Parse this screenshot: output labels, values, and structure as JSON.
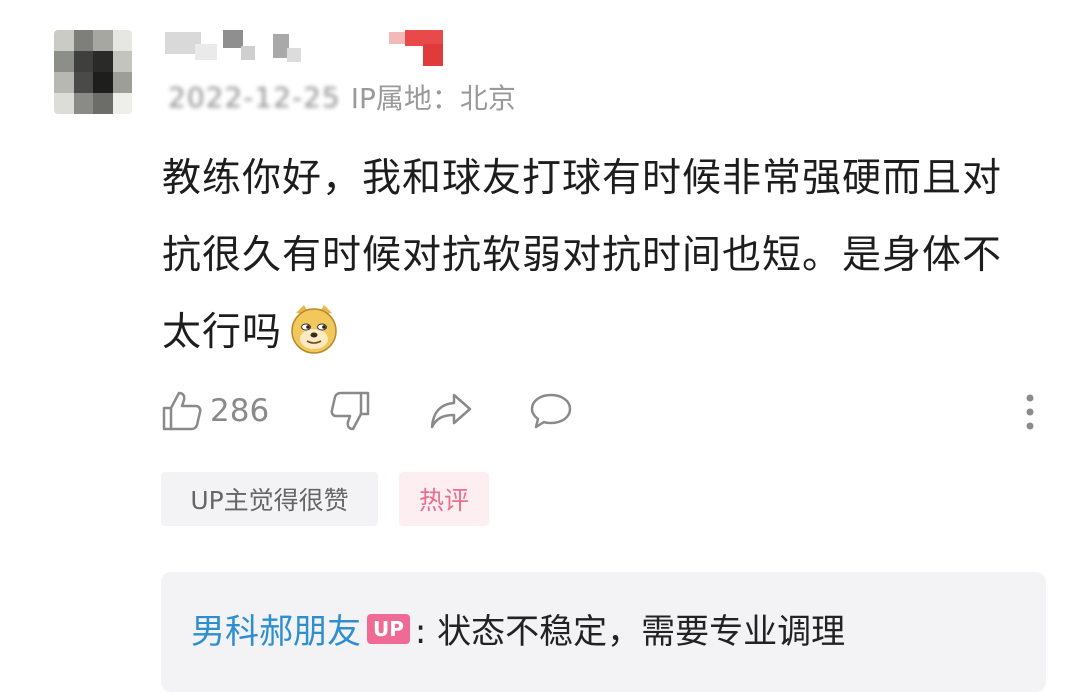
{
  "comment": {
    "meta": {
      "date": "2022-12-25",
      "ip_location": "IP属地：北京"
    },
    "text_lines": [
      "教练你好，我和球友打球有时候非常强硬而且对",
      "抗很久有时候对抗软弱对抗时间也短。是身体不",
      "太行吗"
    ],
    "emoji_icon": "doge-emoji-icon",
    "like_count": "286"
  },
  "tags": {
    "up_liked": "UP主觉得很赞",
    "hot": "热评"
  },
  "reply": {
    "author": "男科郝朋友",
    "badge": "UP",
    "text": ": 状态不稳定，需要专业调理"
  },
  "icons": [
    "like-icon",
    "dislike-icon",
    "share-icon",
    "comment-icon",
    "more-icon"
  ],
  "colors": {
    "accent_blue": "#2e8fd0",
    "up_badge_pink": "#f06a96",
    "hot_tag_text": "#ea6f8e",
    "hot_tag_bg": "#fdeef2",
    "panel_gray": "#f3f3f5"
  }
}
